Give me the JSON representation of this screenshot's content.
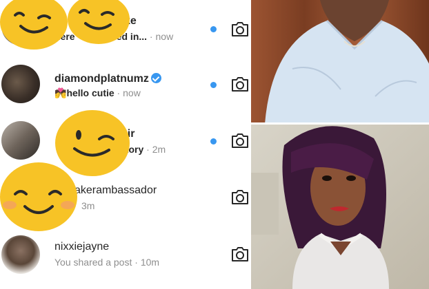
{
  "threads": [
    {
      "name": "ke",
      "preview": "here",
      "preview_rest": "based in...",
      "time": "now",
      "unread": true,
      "verified": false
    },
    {
      "name": "diamondplatnumz",
      "preview": "hello cutie",
      "time": "now",
      "unread": true,
      "verified": true,
      "preview_emoji": "💏"
    },
    {
      "name": "bir",
      "preview": "story",
      "time": "2m",
      "unread": true,
      "verified": false
    },
    {
      "name": "akerambassador",
      "preview": "",
      "time": "3m",
      "unread": false,
      "verified": false
    },
    {
      "name": "nixxiejayne",
      "preview": "You shared a post",
      "time": "10m",
      "unread": false,
      "verified": false
    }
  ],
  "separator": " · ",
  "icons": {
    "camera": "camera-icon",
    "unread": "unread-dot-icon",
    "verified": "verified-badge-icon",
    "wink": "winking-emoji-sticker",
    "smile": "smiling-emoji-sticker"
  },
  "colors": {
    "accent": "#3897f0",
    "emoji": "#f7c326",
    "text": "#262626",
    "muted": "#8e8e8e"
  }
}
